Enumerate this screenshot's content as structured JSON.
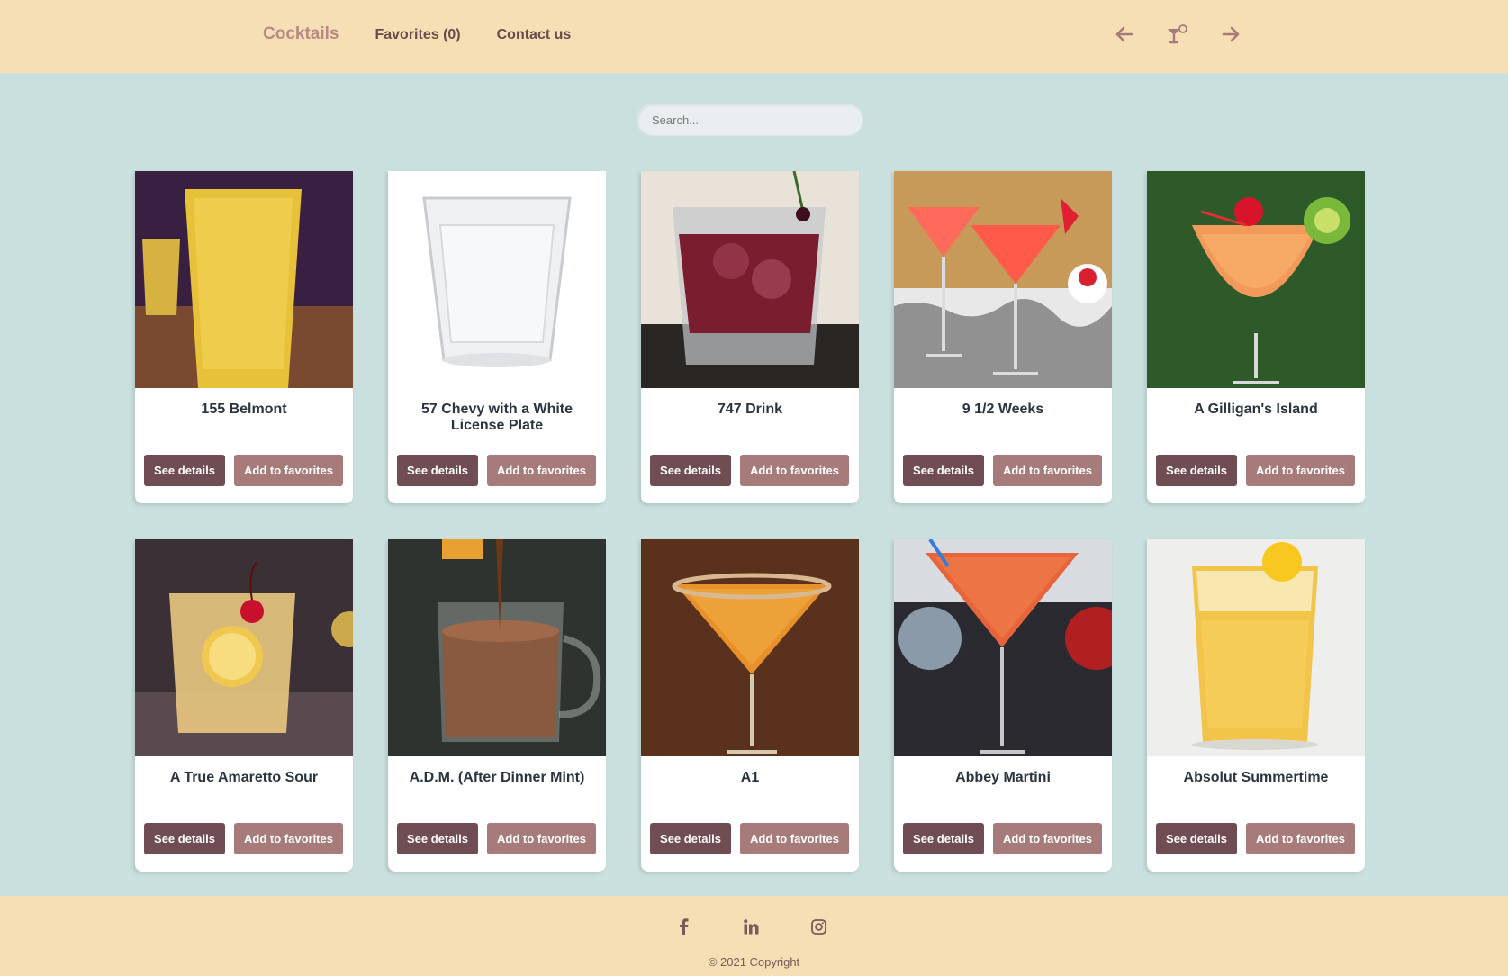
{
  "header": {
    "brand": "Cocktails",
    "favorites_link": "Favorites (0)",
    "contact_link": "Contact us",
    "icons": [
      "arrow-left-icon",
      "cocktail-glass-icon",
      "arrow-right-icon"
    ]
  },
  "search": {
    "placeholder": "Search...",
    "value": ""
  },
  "cards": [
    {
      "title": "155 Belmont",
      "details_label": "See details",
      "fav_label": "Add to favorites"
    },
    {
      "title": "57 Chevy with a White License Plate",
      "details_label": "See details",
      "fav_label": "Add to favorites"
    },
    {
      "title": "747 Drink",
      "details_label": "See details",
      "fav_label": "Add to favorites"
    },
    {
      "title": "9 1/2 Weeks",
      "details_label": "See details",
      "fav_label": "Add to favorites"
    },
    {
      "title": "A Gilligan's Island",
      "details_label": "See details",
      "fav_label": "Add to favorites"
    },
    {
      "title": "A True Amaretto Sour",
      "details_label": "See details",
      "fav_label": "Add to favorites"
    },
    {
      "title": "A.D.M. (After Dinner Mint)",
      "details_label": "See details",
      "fav_label": "Add to favorites"
    },
    {
      "title": "A1",
      "details_label": "See details",
      "fav_label": "Add to favorites"
    },
    {
      "title": "Abbey Martini",
      "details_label": "See details",
      "fav_label": "Add to favorites"
    },
    {
      "title": "Absolut Summertime",
      "details_label": "See details",
      "fav_label": "Add to favorites"
    }
  ],
  "footer": {
    "social_icons": [
      "facebook-icon",
      "linkedin-icon",
      "instagram-icon"
    ],
    "copyright": "© 2021 Copyright"
  },
  "colors": {
    "header_bg": "#f6dfb4",
    "page_bg": "#c9e0de",
    "brand": "#b98a83",
    "nav_text": "#6b4b4b",
    "btn_details": "#704d52",
    "btn_fav": "#a87b7b"
  }
}
